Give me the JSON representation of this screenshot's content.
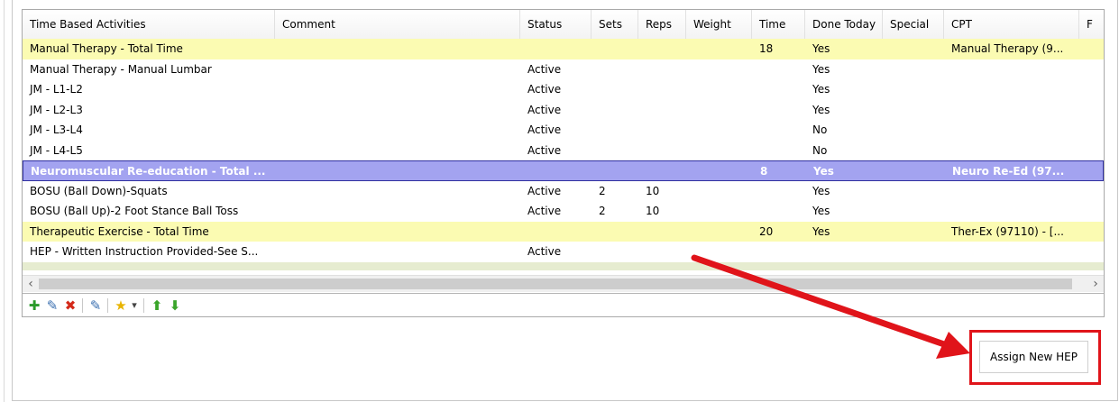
{
  "columns": [
    {
      "label": "Time Based Activities"
    },
    {
      "label": "Comment"
    },
    {
      "label": "Status"
    },
    {
      "label": "Sets"
    },
    {
      "label": "Reps"
    },
    {
      "label": "Weight"
    },
    {
      "label": "Time"
    },
    {
      "label": "Done Today"
    },
    {
      "label": "Special"
    },
    {
      "label": "CPT"
    },
    {
      "label": "F"
    }
  ],
  "rows": [
    {
      "style": "yellow",
      "activity": "Manual Therapy - Total Time",
      "status": "",
      "sets": "",
      "reps": "",
      "time": "18",
      "done": "Yes",
      "cpt": "Manual Therapy (9..."
    },
    {
      "style": "",
      "activity": "Manual Therapy - Manual Lumbar",
      "status": "Active",
      "sets": "",
      "reps": "",
      "time": "",
      "done": "Yes",
      "cpt": ""
    },
    {
      "style": "",
      "activity": "JM - L1-L2",
      "status": "Active",
      "sets": "",
      "reps": "",
      "time": "",
      "done": "Yes",
      "cpt": ""
    },
    {
      "style": "",
      "activity": "JM - L2-L3",
      "status": "Active",
      "sets": "",
      "reps": "",
      "time": "",
      "done": "Yes",
      "cpt": ""
    },
    {
      "style": "",
      "activity": "JM - L3-L4",
      "status": "Active",
      "sets": "",
      "reps": "",
      "time": "",
      "done": "No",
      "cpt": ""
    },
    {
      "style": "",
      "activity": "JM - L4-L5",
      "status": "Active",
      "sets": "",
      "reps": "",
      "time": "",
      "done": "No",
      "cpt": ""
    },
    {
      "style": "blue",
      "activity": "Neuromuscular Re-education - Total ...",
      "status": "",
      "sets": "",
      "reps": "",
      "time": "8",
      "done": "Yes",
      "cpt": "Neuro Re-Ed (97..."
    },
    {
      "style": "",
      "activity": "BOSU (Ball Down)-Squats",
      "status": "Active",
      "sets": "2",
      "reps": "10",
      "time": "",
      "done": "Yes",
      "cpt": ""
    },
    {
      "style": "",
      "activity": "BOSU (Ball Up)-2 Foot Stance Ball Toss",
      "status": "Active",
      "sets": "2",
      "reps": "10",
      "time": "",
      "done": "Yes",
      "cpt": ""
    },
    {
      "style": "yellow",
      "activity": "Therapeutic Exercise - Total Time",
      "status": "",
      "sets": "",
      "reps": "",
      "time": "20",
      "done": "Yes",
      "cpt": "Ther-Ex (97110) - [..."
    },
    {
      "style": "",
      "activity": "HEP - Written Instruction Provided-See S...",
      "status": "Active",
      "sets": "",
      "reps": "",
      "time": "",
      "done": "",
      "cpt": ""
    }
  ],
  "scroll_left_glyph": "‹",
  "scroll_right_glyph": "›",
  "toolbar_icons": [
    {
      "name": "add-icon",
      "glyph": "✚",
      "color": "#2a9a2a"
    },
    {
      "name": "edit-icon",
      "glyph": "✎",
      "color": "#3a6fb0"
    },
    {
      "name": "delete-icon",
      "glyph": "✖",
      "color": "#d42a1a"
    },
    {
      "name": "note-icon",
      "glyph": "✎",
      "color": "#3a6fb0"
    },
    {
      "name": "favorite-icon",
      "glyph": "★",
      "color": "#e8b400"
    },
    {
      "name": "favorite-dropdown-icon",
      "glyph": "▾",
      "color": "#444444"
    },
    {
      "name": "move-up-icon",
      "glyph": "⬆",
      "color": "#3aa52a"
    },
    {
      "name": "move-down-icon",
      "glyph": "⬇",
      "color": "#3aa52a"
    }
  ],
  "assign_button_label": "Assign New HEP",
  "colors": {
    "highlight_row": "#fbfbb2",
    "selected_row": "#a3a3f0",
    "callout": "#e0141a"
  }
}
